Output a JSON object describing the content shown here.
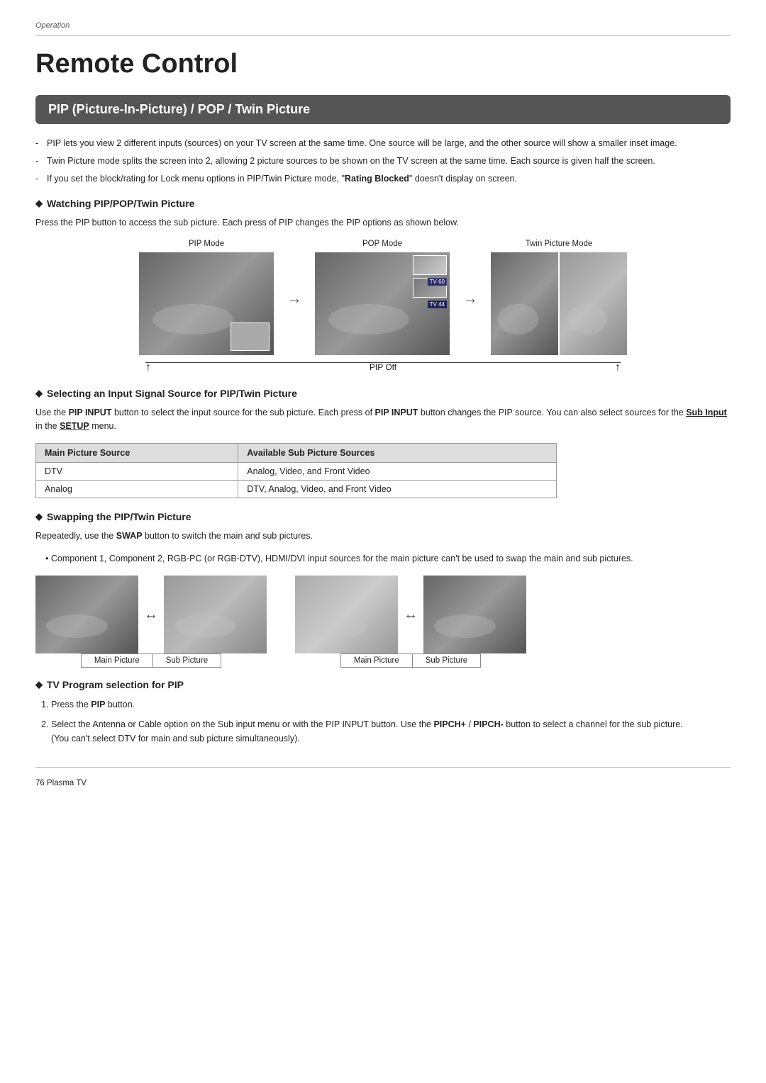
{
  "page": {
    "section_label": "Operation",
    "title": "Remote Control",
    "section_header": "PIP (Picture-In-Picture) / POP / Twin Picture",
    "bullets": [
      "PIP lets you view 2 different inputs (sources) on your TV screen at the same time. One source will be large, and the other source will show a smaller inset image.",
      "Twin Picture mode splits the screen into 2, allowing 2 picture sources to be shown on the TV screen at the same time. Each source is given half the screen.",
      "If you set the block/rating for Lock menu options in PIP/Twin Picture mode, \"Rating Blocked\" doesn't display on screen."
    ],
    "watching_title": "Watching PIP/POP/Twin Picture",
    "watching_text": "Press the PIP button to access the sub picture. Each press of PIP changes the PIP options as shown below.",
    "pip_mode_label": "PIP Mode",
    "pop_mode_label": "POP Mode",
    "twin_mode_label": "Twin Picture Mode",
    "pip_off_label": "PIP Off",
    "selecting_title": "Selecting an Input Signal Source for PIP/Twin Picture",
    "selecting_text_1": "Use the ",
    "pip_input_bold": "PIP INPUT",
    "selecting_text_2": " button to select the input source for the sub picture. Each press of ",
    "pip_input_bold2": "PIP INPUT",
    "selecting_text_3": " button changes the PIP source. You can also select sources for the ",
    "sub_input_bold": "Sub Input",
    "selecting_text_4": " in the ",
    "setup_underline": "SETUP",
    "selecting_text_5": " menu.",
    "table": {
      "col1_header": "Main Picture Source",
      "col2_header": "Available Sub Picture Sources",
      "rows": [
        {
          "col1": "DTV",
          "col2": "Analog, Video, and Front Video"
        },
        {
          "col1": "Analog",
          "col2": "DTV, Analog, Video, and Front Video"
        }
      ]
    },
    "swapping_title": "Swapping the PIP/Twin Picture",
    "swapping_text1": "Repeatedly, use the ",
    "swap_bold": "SWAP",
    "swapping_text2": " button to switch the main and sub pictures.",
    "swapping_bullet": "Component 1, Component 2, RGB-PC (or RGB-DTV), HDMI/DVI input sources for the main picture can't be used to swap the main and sub pictures.",
    "main_picture_label": "Main Picture",
    "sub_picture_label": "Sub Picture",
    "tv_program_title": "TV Program selection for PIP",
    "tv_steps": [
      {
        "text": "Press the ",
        "bold": "PIP",
        "text2": " button."
      },
      {
        "text": "Select the Antenna or Cable option on the Sub input menu or with the PIP INPUT button. Use the ",
        "bold": "PIPCH+",
        "text2": " / ",
        "bold2": "PIPCH-",
        "text3": " button to select a channel for the sub picture.\n(You can't select DTV for main and sub picture simultaneously)."
      }
    ],
    "page_number": "76  Plasma TV"
  }
}
